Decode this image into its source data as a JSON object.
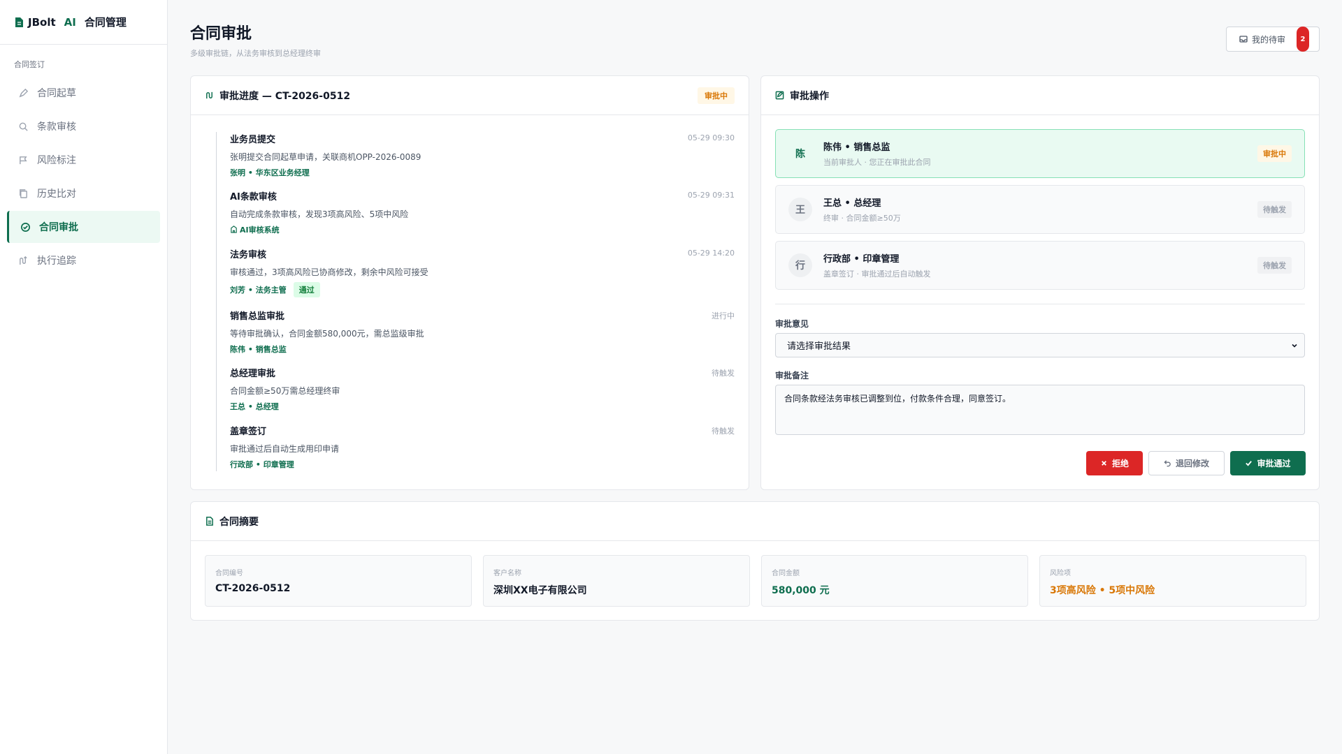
{
  "brand": {
    "name": "JBolt",
    "ai": "AI",
    "title": "合同管理"
  },
  "sidebar": {
    "section": "合同签订",
    "items": [
      {
        "label": "合同起草",
        "icon": "pen-icon"
      },
      {
        "label": "条款审核",
        "icon": "search-icon"
      },
      {
        "label": "风险标注",
        "icon": "flag-icon"
      },
      {
        "label": "历史比对",
        "icon": "copy-icon"
      },
      {
        "label": "合同审批",
        "icon": "check-circle-icon",
        "active": true
      },
      {
        "label": "执行追踪",
        "icon": "route-icon"
      }
    ]
  },
  "header": {
    "title": "合同审批",
    "subtitle": "多级审批链，从法务审核到总经理终审",
    "todo_label": "我的待审",
    "todo_count": "2"
  },
  "progress": {
    "title": "审批进度 — CT-2026-0512",
    "status": "审批中",
    "steps": [
      {
        "title": "业务员提交",
        "time": "05-29 09:30",
        "desc": "张明提交合同起草申请，关联商机OPP-2026-0089",
        "meta": "张明 • 华东区业务经理"
      },
      {
        "title": "AI条款审核",
        "time": "05-29 09:31",
        "desc": "自动完成条款审核，发现3项高风险、5项中风险",
        "meta": "AI审核系统"
      },
      {
        "title": "法务审核",
        "time": "05-29 14:20",
        "desc": "审核通过，3项高风险已协商修改，剩余中风险可接受",
        "meta": "刘芳 • 法务主管",
        "pill": "通过"
      },
      {
        "title": "销售总监审批",
        "time": "进行中",
        "desc": "等待审批确认，合同金额580,000元，需总监级审批",
        "meta": "陈伟 • 销售总监"
      },
      {
        "title": "总经理审批",
        "time": "待触发",
        "desc": "合同金额≥50万需总经理终审",
        "meta": "王总 • 总经理"
      },
      {
        "title": "盖章签订",
        "time": "待触发",
        "desc": "审批通过后自动生成用印申请",
        "meta": "行政部 • 印章管理"
      }
    ]
  },
  "operation": {
    "title": "审批操作",
    "approvers": [
      {
        "avatar": "陈",
        "name": "陈伟 • 销售总监",
        "sub": "当前审批人 · 您正在审批此合同",
        "status": "审批中"
      },
      {
        "avatar": "王",
        "name": "王总 • 总经理",
        "sub": "终审 · 合同金额≥50万",
        "status": "待触发"
      },
      {
        "avatar": "行",
        "name": "行政部 • 印章管理",
        "sub": "盖章签订 · 审批通过后自动触发",
        "status": "待触发"
      }
    ],
    "opinion_label": "审批意见",
    "opinion_value": "请选择审批结果",
    "remark_label": "审批备注",
    "remark_value": "合同条款经法务审核已调整到位，付款条件合理，同意签订。",
    "reject_label": "拒绝",
    "return_label": "退回修改",
    "approve_label": "审批通过"
  },
  "summary": {
    "title": "合同摘要",
    "items": [
      {
        "label": "合同编号",
        "value": "CT-2026-0512"
      },
      {
        "label": "客户名称",
        "value": "深圳XX电子有限公司"
      },
      {
        "label": "合同金额",
        "value": "580,000 元"
      },
      {
        "label": "风险项",
        "value": "3项高风险 • 5项中风险"
      }
    ]
  },
  "colors": {
    "accent": "#0f6e4f",
    "danger": "#dc2626",
    "warning": "#d97706"
  }
}
